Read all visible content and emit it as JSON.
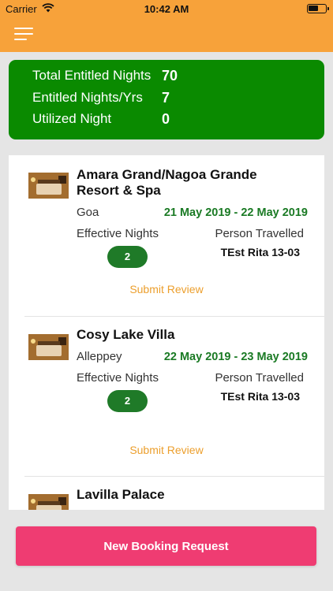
{
  "status_bar": {
    "carrier": "Carrier",
    "wifi_icon": "wifi-icon",
    "time": "10:42 AM",
    "battery_level": 0.6
  },
  "nav": {
    "menu_icon": "hamburger-menu-icon",
    "background_color": "#f7a23a"
  },
  "summary": {
    "background_color": "#0a8a00",
    "rows": [
      {
        "label": "Total Entitled Nights",
        "value": "70"
      },
      {
        "label": "Entitled Nights/Yrs",
        "value": "7"
      },
      {
        "label": "Utilized Night",
        "value": "0"
      }
    ]
  },
  "bookings": [
    {
      "hotel": "Amara Grand/Nagoa Grande Resort & Spa",
      "location": "Goa",
      "dates": "21 May 2019 - 22 May 2019",
      "effective_nights_label": "Effective Nights",
      "effective_nights": "2",
      "person_label": "Person Travelled",
      "person": "TEst Rita 13-03",
      "review_label": "Submit Review"
    },
    {
      "hotel": "Cosy Lake Villa",
      "location": "Alleppey",
      "dates": "22 May 2019 - 23 May 2019",
      "effective_nights_label": "Effective Nights",
      "effective_nights": "2",
      "person_label": "Person Travelled",
      "person": "TEst Rita 13-03",
      "review_label": "Submit Review"
    },
    {
      "hotel": "Lavilla Palace"
    }
  ],
  "actions": {
    "new_booking_label": "New Booking Request",
    "accent_color": "#ef3c72"
  },
  "colors": {
    "dates": "#1a7a24",
    "badge": "#1f7a28",
    "review_link": "#ec9f2d"
  }
}
